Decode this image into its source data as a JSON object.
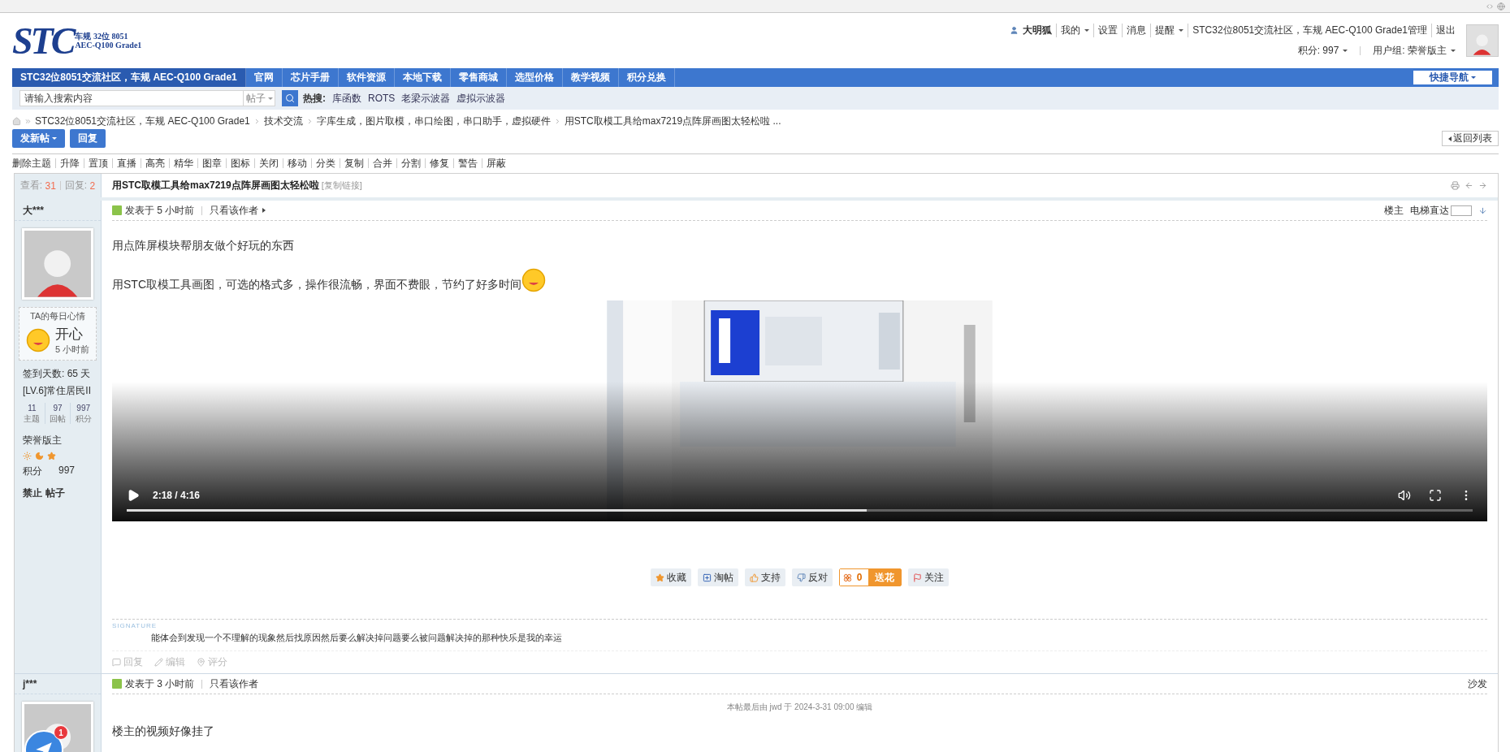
{
  "logo": {
    "text": "STC",
    "line1": "车规 32位 8051",
    "line2": "AEC-Q100 Grade1"
  },
  "user_menu": {
    "username": "大明狐",
    "links": [
      {
        "label": "我的",
        "dropdown": true
      },
      {
        "label": "设置",
        "dropdown": false
      },
      {
        "label": "消息",
        "dropdown": false
      },
      {
        "label": "提醒",
        "dropdown": true
      },
      {
        "label": "STC32位8051交流社区，车规 AEC-Q100 Grade1管理",
        "dropdown": false
      },
      {
        "label": "退出",
        "dropdown": false
      }
    ],
    "credits": "积分: 997",
    "group": "用户组: 荣誉版主"
  },
  "nav": {
    "items": [
      {
        "label": "STC32位8051交流社区，车规 AEC-Q100 Grade1",
        "selected": true
      },
      {
        "label": "官网",
        "selected": false
      },
      {
        "label": "芯片手册",
        "selected": false
      },
      {
        "label": "软件资源",
        "selected": false
      },
      {
        "label": "本地下载",
        "selected": false
      },
      {
        "label": "零售商城",
        "selected": false
      },
      {
        "label": "选型价格",
        "selected": false
      },
      {
        "label": "教学视频",
        "selected": false
      },
      {
        "label": "积分兑换",
        "selected": false
      }
    ],
    "quick_nav": "快捷导航"
  },
  "search": {
    "placeholder": "请输入搜索内容",
    "scope": "帖子",
    "hot_label": "热搜:",
    "hot": [
      "库函数",
      "ROTS",
      "老梁示波器",
      "虚拟示波器"
    ]
  },
  "breadcrumb": [
    "STC32位8051交流社区，车规 AEC-Q100 Grade1",
    "技术交流",
    "字库生成，图片取模，串口绘图，串口助手，虚拟硬件",
    "用STC取模工具给max7219点阵屏画图太轻松啦 ..."
  ],
  "actions": {
    "new_post": "发新帖",
    "reply": "回复",
    "back": "返回列表"
  },
  "mod_tools": [
    "删除主题",
    "升降",
    "置顶",
    "直播",
    "高亮",
    "精华",
    "图章",
    "图标",
    "关闭",
    "移动",
    "分类",
    "复制",
    "合并",
    "分割",
    "修复",
    "警告",
    "屏蔽"
  ],
  "thread": {
    "views_label": "查看:",
    "views": "31",
    "replies_label": "回复:",
    "replies": "2",
    "title": "用STC取模工具给max7219点阵屏画图太轻松啦",
    "copy_link": "[复制链接]"
  },
  "posts": [
    {
      "author": "大***",
      "mood": {
        "heading": "TA的每日心情",
        "mood": "开心",
        "time": "5 小时前"
      },
      "checkin": "签到天数: 65 天",
      "level": "[LV.6]常住居民II",
      "stats": [
        {
          "value": "11",
          "label": "主题"
        },
        {
          "value": "97",
          "label": "回帖"
        },
        {
          "value": "997",
          "label": "积分"
        }
      ],
      "rank": "荣誉版主",
      "credits_label": "积分",
      "credits": "997",
      "admin_links": [
        "禁止",
        "帖子"
      ],
      "posted": "发表于 5 小时前",
      "author_only": "只看该作者",
      "floor": "楼主",
      "jump_label": "电梯直达",
      "paragraphs": [
        "用点阵屏模块帮朋友做个好玩的东西",
        "用STC取模工具画图，可选的格式多，操作很流畅，界面不费眼，节约了好多时间"
      ],
      "video": {
        "kind": "picture",
        "time": "2:18 / 4:16",
        "level": 0.55
      },
      "buttons": [
        {
          "kind": "favorite",
          "label": "收藏"
        },
        {
          "kind": "share",
          "label": "淘帖"
        },
        {
          "kind": "support",
          "label": "支持"
        },
        {
          "kind": "oppose",
          "label": "反对"
        }
      ],
      "flowers": {
        "count": "0",
        "label": "送花"
      },
      "follow": "关注",
      "signature_label": "SIGNATURE",
      "signature": "能体会到发现一个不理解的现象然后找原因然后要么解决掉问题要么被问题解决掉的那种快乐是我的幸运",
      "footer_links": [
        "回复",
        "编辑",
        "评分"
      ]
    },
    {
      "author": "j***",
      "avatar_badge": "1",
      "posted": "发表于 3 小时前",
      "author_only": "只看该作者",
      "floor": "沙发",
      "edit_note": "本帖最后由 jwd 于 2024-3-31 09:00 编辑",
      "paragraphs": [
        "楼主的视频好像挂了"
      ]
    }
  ]
}
